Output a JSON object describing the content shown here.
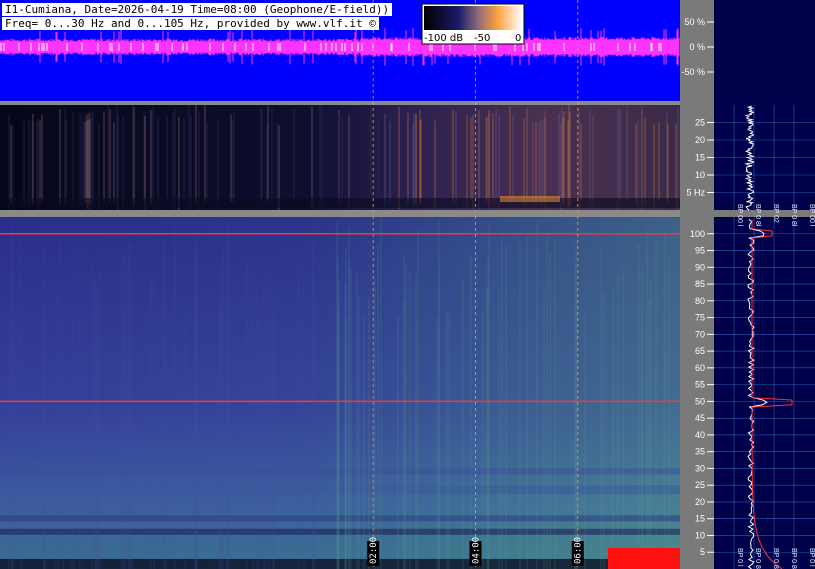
{
  "header": {
    "title_line": "I1-Cumiana, Date=2026-04-19 Time=08:00 (Geophone/E-field))",
    "freq_line": "Freq= 0...30 Hz and 0...105 Hz, provided by www.vlf.it ©"
  },
  "colorbar": {
    "labels": [
      "-100 dB",
      "-50",
      "0"
    ]
  },
  "waveform_axis": {
    "labels": [
      "50 %",
      "0 %",
      "-50 %"
    ],
    "values": [
      50,
      0,
      -50
    ]
  },
  "time_markers": {
    "labels": [
      "02:00",
      "04:00",
      "06:00"
    ],
    "hours": [
      2,
      4,
      6
    ],
    "range_hours": [
      -5.3,
      8
    ]
  },
  "low_spectrogram_axis": {
    "labels": [
      "25",
      "20",
      "15",
      "10",
      "5 Hz"
    ],
    "values": [
      25,
      20,
      15,
      10,
      5
    ],
    "range": [
      0,
      30
    ]
  },
  "high_spectrogram_axis": {
    "labels": [
      "100",
      "95",
      "90",
      "85",
      "80",
      "75",
      "70",
      "65",
      "60",
      "55",
      "50",
      "45",
      "40",
      "35",
      "30",
      "25",
      "20",
      "15",
      "10",
      "5"
    ],
    "values": [
      100,
      95,
      90,
      85,
      80,
      75,
      70,
      65,
      60,
      55,
      50,
      45,
      40,
      35,
      30,
      25,
      20,
      15,
      10,
      5
    ],
    "range": [
      0,
      105
    ]
  },
  "bp_labels_low": [
    "BP 00 l",
    "BP 0 8l",
    "BP 02",
    "BP 0 8l",
    "BP 00 l"
  ],
  "bp_labels_high": [
    "BP 0 l",
    "BP 0 8l",
    "BP 0 8l",
    "BP 0 8l",
    "BP 0 l"
  ],
  "colors": {
    "waveform_bg": "#0000ff",
    "waveform": "#ff33ff",
    "marker": "#ff9933",
    "mains_line": "#ff3333",
    "side_panel": "#00004a",
    "axis_bg": "#7a7a7a",
    "grid": "#3aa0ff"
  }
}
